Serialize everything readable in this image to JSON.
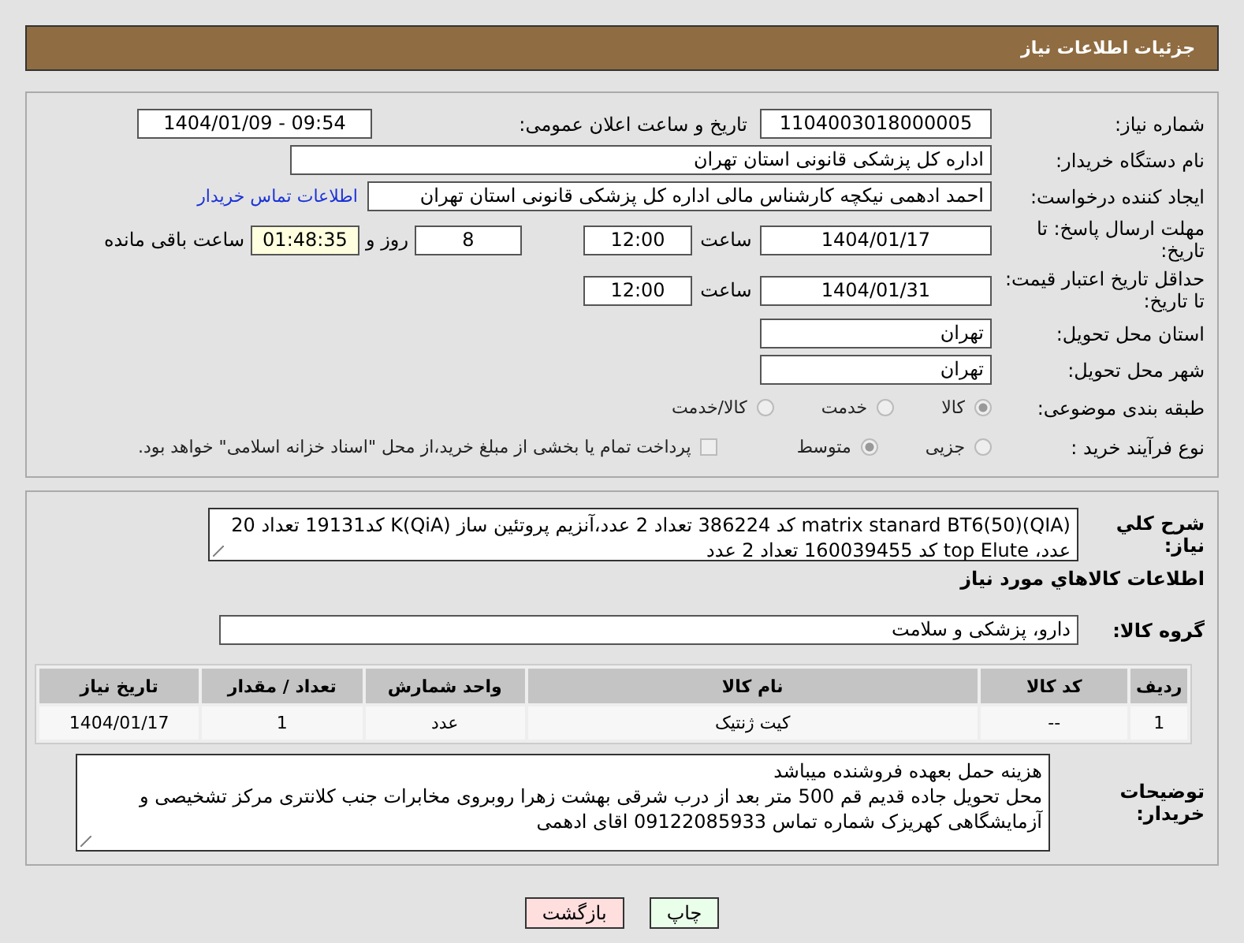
{
  "header": {
    "title": "جزئیات اطلاعات نیاز"
  },
  "need_number": {
    "label": "شماره نیاز:",
    "value": "1104003018000005"
  },
  "announce": {
    "label": "تاریخ و ساعت اعلان عمومی:",
    "value": "1404/01/09 - 09:54"
  },
  "buyer_org": {
    "label": "نام دستگاه خریدار:",
    "value": "اداره کل پزشکی قانونی استان تهران"
  },
  "creator": {
    "label": "ایجاد کننده درخواست:",
    "value": "احمد ادهمی نیکچه کارشناس مالی اداره کل پزشکی قانونی استان تهران",
    "link": "اطلاعات تماس خریدار"
  },
  "deadline": {
    "label": "مهلت ارسال پاسخ: تا تاریخ:",
    "date": "1404/01/17",
    "time_label": "ساعت",
    "time": "12:00",
    "days": "8",
    "days_label": "روز و",
    "remaining": "01:48:35",
    "remaining_label": "ساعت باقی مانده"
  },
  "validity": {
    "label": "حداقل تاریخ اعتبار قیمت: تا تاریخ:",
    "date": "1404/01/31",
    "time_label": "ساعت",
    "time": "12:00"
  },
  "province": {
    "label": "استان محل تحویل:",
    "value": "تهران"
  },
  "city": {
    "label": "شهر محل تحویل:",
    "value": "تهران"
  },
  "category": {
    "label": "طبقه بندی موضوعی:",
    "options": [
      {
        "label": "کالا",
        "selected": true
      },
      {
        "label": "خدمت",
        "selected": false
      },
      {
        "label": "کالا/خدمت",
        "selected": false
      }
    ]
  },
  "process": {
    "label": "نوع فرآیند خرید :",
    "options": [
      {
        "label": "جزیی",
        "selected": false
      },
      {
        "label": "متوسط",
        "selected": true
      }
    ],
    "payment": {
      "label": "پرداخت تمام یا بخشی از مبلغ خرید،از محل \"اسناد خزانه اسلامی\" خواهد بود.",
      "checked": false
    }
  },
  "description": {
    "label": "شرح کلي نیاز:",
    "value": "matrix stanard BT6(50)(QIA) کد 386224 تعداد 2 عدد،آنزیم پروتئین ساز K(QiA) کد19131 تعداد 20 عدد، top Elute کد 160039455 تعداد 2 عدد"
  },
  "goods_heading": "اطلاعات کالاهاي مورد نياز",
  "goods_group": {
    "label": "گروه کالا:",
    "value": "دارو، پزشکی و سلامت"
  },
  "table": {
    "columns": [
      "ردیف",
      "کد کالا",
      "نام کالا",
      "واحد شمارش",
      "تعداد / مقدار",
      "تاریخ نیاز"
    ],
    "rows": [
      [
        "1",
        "--",
        "کیت ژنتیک",
        "عدد",
        "1",
        "1404/01/17"
      ]
    ]
  },
  "buyer_notes": {
    "label": "توضیحات خریدار:",
    "lines": [
      "هزینه حمل بعهده فروشنده میباشد",
      "محل تحویل جاده قدیم قم 500 متر بعد از درب شرقی بهشت زهرا روبروی مخابرات جنب کلانتری مرکز تشخیصی و آزمایشگاهی کهریزک شماره تماس 09122085933 اقای ادهمی"
    ]
  },
  "buttons": [
    {
      "kind": "print",
      "label": "چاپ"
    },
    {
      "kind": "back",
      "label": "بازگشت"
    }
  ]
}
